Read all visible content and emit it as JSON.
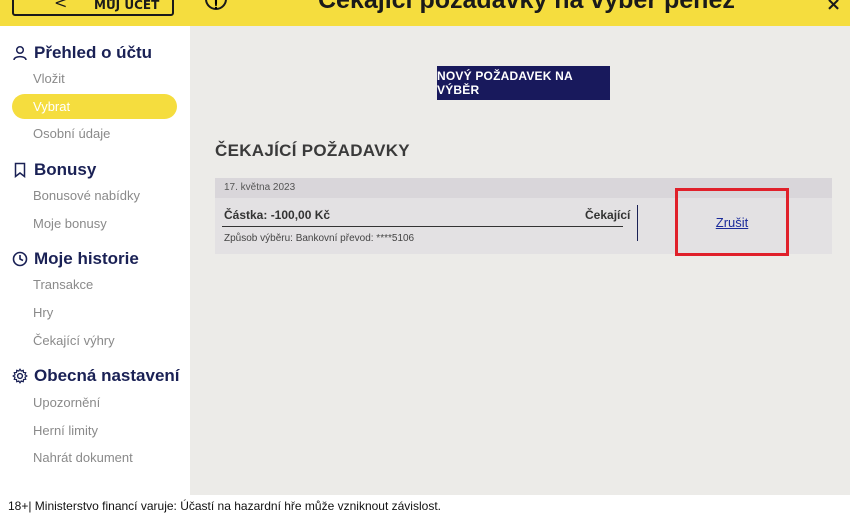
{
  "header": {
    "back_label": "MŮJ ÚČET",
    "title": "Čekající požadavky na výběr peněz",
    "close_glyph": "×",
    "info_glyph": "!"
  },
  "sidebar": {
    "sections": [
      {
        "title": "Přehled o účtu",
        "icon": "user-icon",
        "items": [
          "Vložit",
          "Vybrat",
          "Osobní údaje"
        ]
      },
      {
        "title": "Bonusy",
        "icon": "bookmark-icon",
        "items": [
          "Bonusové nabídky",
          "Moje bonusy"
        ]
      },
      {
        "title": "Moje historie",
        "icon": "clock-icon",
        "items": [
          "Transakce",
          "Hry",
          "Čekající výhry"
        ]
      },
      {
        "title": "Obecná nastavení",
        "icon": "gear-icon",
        "items": [
          "Upozornění",
          "Herní limity",
          "Nahrát dokument"
        ]
      }
    ],
    "active_item": "Vybrat"
  },
  "main": {
    "new_request_button": "NOVÝ POŽADAVEK NA VÝBĚR",
    "pending_title": "ČEKAJÍCÍ POŽADAVKY",
    "request": {
      "date": "17. května 2023",
      "amount": "Částka: -100,00 Kč",
      "status": "Čekající",
      "method": "Způsob výběru: Bankovní převod: ****5106",
      "cancel_label": "Zrušit"
    }
  },
  "footer": {
    "notice": "18+| Ministerstvo financí varuje: Účastí na hazardní hře může vzniknout závislost."
  },
  "colors": {
    "brand_yellow": "#f5dd3e",
    "navy": "#18195c",
    "highlight_red": "#e0202a"
  }
}
